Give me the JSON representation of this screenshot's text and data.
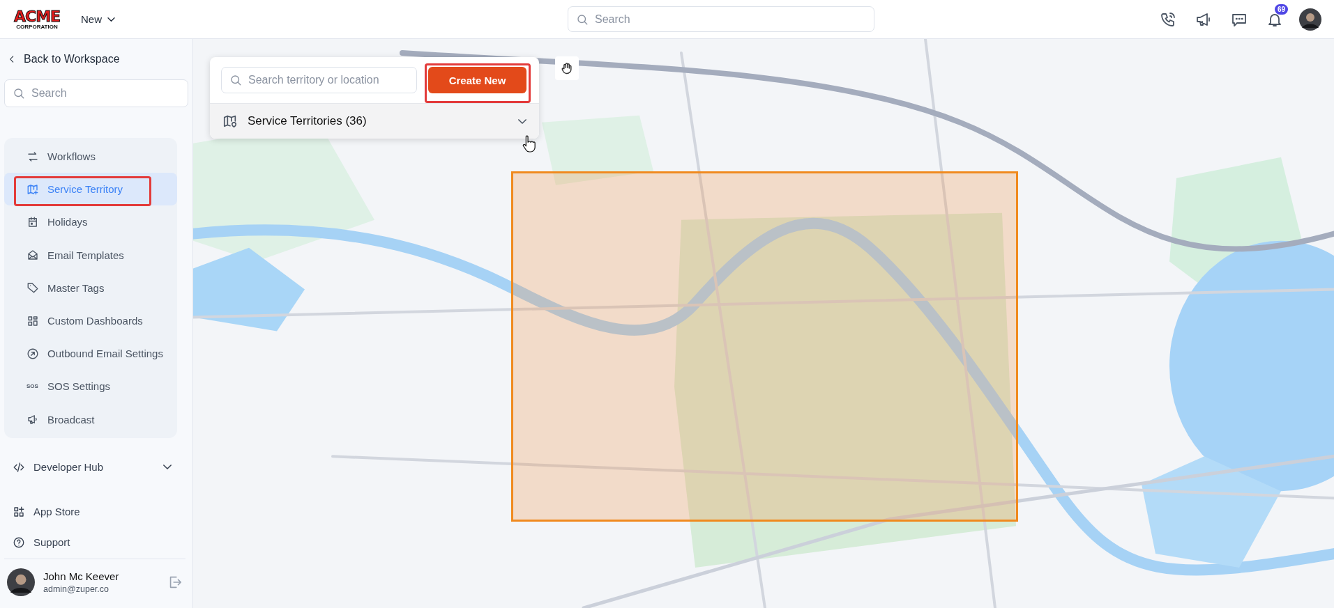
{
  "header": {
    "logo": {
      "word": "ACME",
      "subtitle": "CORPORATION"
    },
    "new_menu": "New",
    "search": {
      "placeholder": "Search"
    },
    "notification_count": "69"
  },
  "sidebar": {
    "back_link": "Back to Workspace",
    "search": {
      "placeholder": "Search"
    },
    "items": [
      {
        "label": "Workflows",
        "selected": false
      },
      {
        "label": "Service Territory",
        "selected": true
      },
      {
        "label": "Holidays",
        "selected": false
      },
      {
        "label": "Email Templates",
        "selected": false
      },
      {
        "label": "Master Tags",
        "selected": false
      },
      {
        "label": "Custom Dashboards",
        "selected": false
      },
      {
        "label": "Outbound Email Settings",
        "selected": false
      },
      {
        "label": "SOS Settings",
        "selected": false,
        "icon_text": "SOS"
      },
      {
        "label": "Broadcast",
        "selected": false
      }
    ],
    "developer_hub": {
      "label": "Developer Hub",
      "expanded": false
    },
    "links": [
      "App Store",
      "Support"
    ],
    "user": {
      "name": "John Mc Keever",
      "email": "admin@zuper.co"
    }
  },
  "panel": {
    "search": {
      "placeholder": "Search territory or location"
    },
    "create_button": "Create New",
    "territories": {
      "label": "Service Territories (36)",
      "expanded": false
    }
  }
}
